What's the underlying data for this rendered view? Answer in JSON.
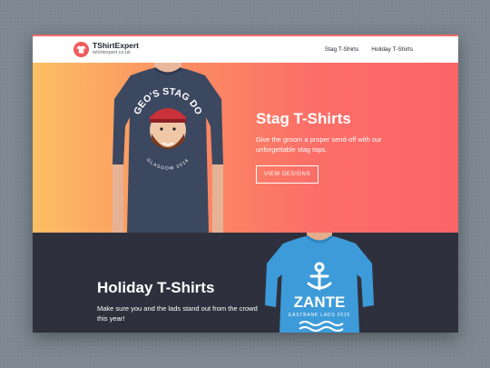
{
  "brand": {
    "name": "TShirtExpert",
    "url": "tshirtexpert.co.uk"
  },
  "nav": {
    "links": [
      "Stag T-Shirts",
      "Holiday T-Shirts"
    ]
  },
  "hero": {
    "title": "Stag T-Shirts",
    "subtitle": "Give the groom a proper send-off with our unforgettable stag tops.",
    "button": "VIEW DESIGNS",
    "shirt_print_top": "GEO'S STAG DO",
    "shirt_print_bottom": "GLASGOW 2016"
  },
  "holiday": {
    "title": "Holiday T-Shirts",
    "subtitle": "Make sure you and the lads stand out from the crowd this year!",
    "shirt_print_main": "ZANTE",
    "shirt_print_sub": "EASTBANK LADS 2015"
  },
  "colors": {
    "accent": "#f15b5b",
    "hero_gradient_start": "#fcbf63",
    "hero_gradient_end": "#fb6469",
    "dark_section": "#2e313d",
    "shirt_navy": "#3c4760",
    "shirt_blue": "#3d9bd9"
  },
  "icons": {
    "logo": "tshirt-icon",
    "anchor": "anchor-icon"
  }
}
